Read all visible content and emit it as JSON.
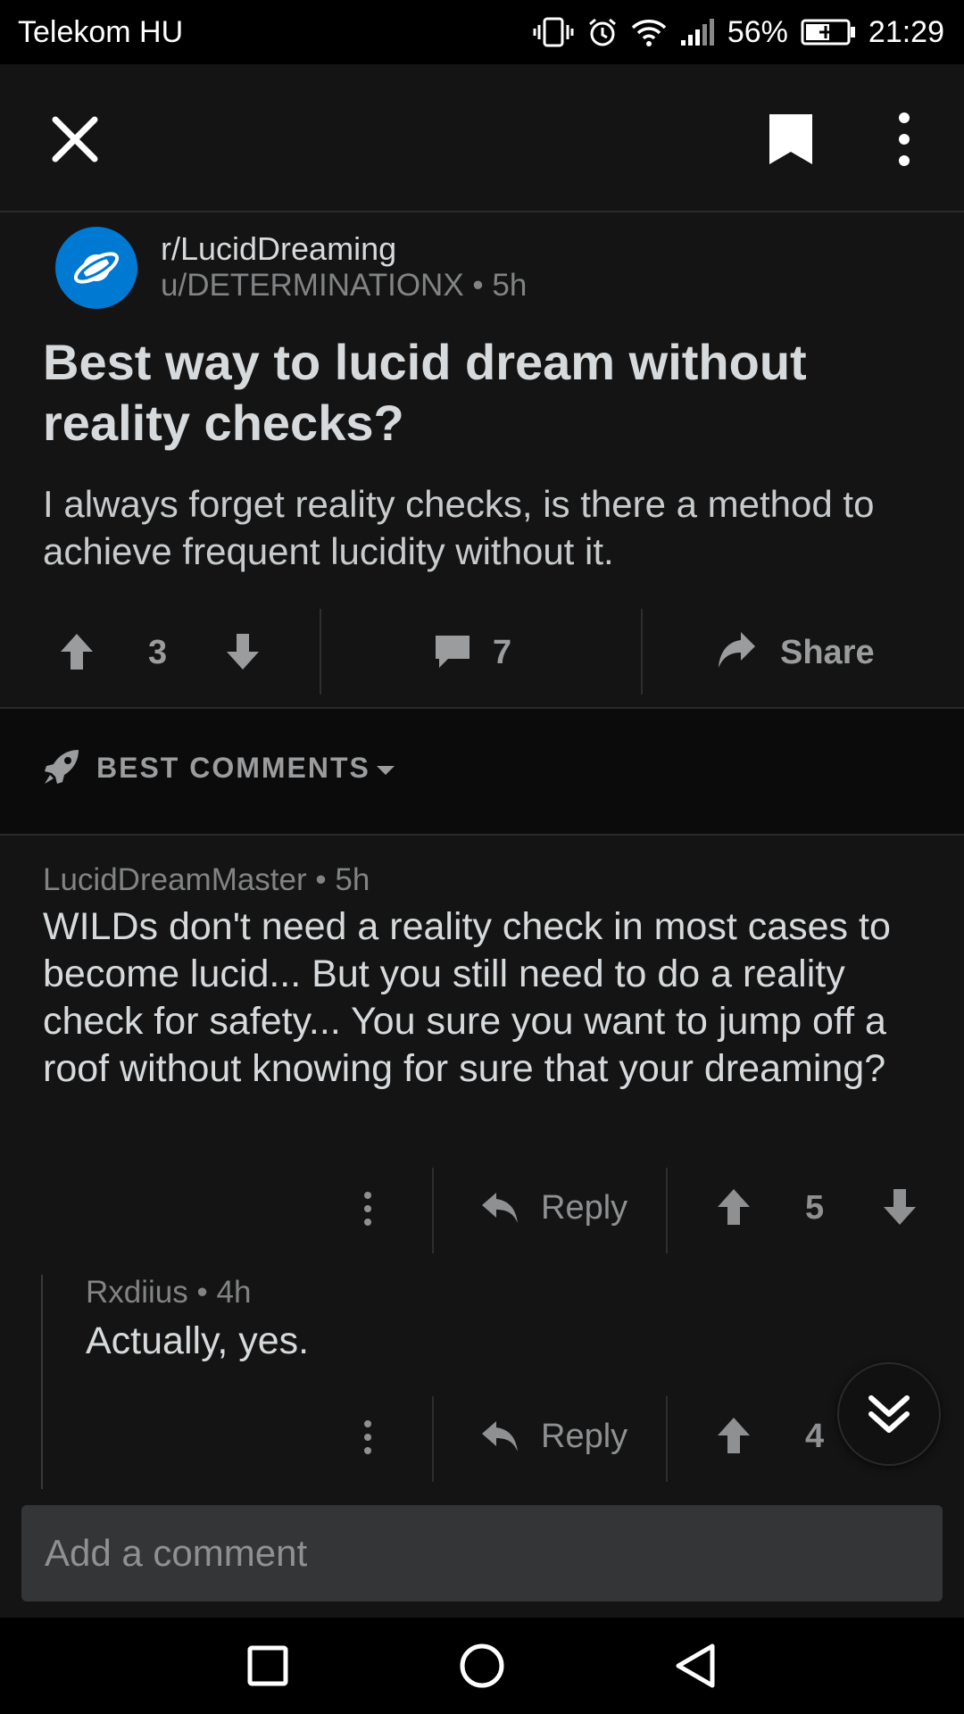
{
  "status_bar": {
    "carrier": "Telekom HU",
    "battery": "56%",
    "time": "21:29"
  },
  "post": {
    "subreddit": "r/LucidDreaming",
    "author": "u/DETERMINATIONX",
    "age": "5h",
    "title": "Best way to lucid dream without reality checks?",
    "body": "I always forget reality checks, is there a method to achieve frequent lucidity without it.",
    "votes": "3",
    "comments_count": "7",
    "share_label": "Share"
  },
  "sort": {
    "label": "BEST COMMENTS"
  },
  "comments": [
    {
      "author": "LucidDreamMaster",
      "age": "5h",
      "body": "WILDs don't need a reality check in most cases to become lucid... But you still need to do a reality check for safety... You sure you want to jump off a roof without knowing for sure that your dreaming?",
      "reply_label": "Reply",
      "votes": "5"
    },
    {
      "author": "Rxdiius",
      "age": "4h",
      "body": "Actually, yes.",
      "reply_label": "Reply",
      "votes": "4"
    }
  ],
  "composer": {
    "placeholder": "Add a comment"
  },
  "colors": {
    "background": "#141414",
    "avatar_blue": "#0079d3",
    "muted_text": "#818384"
  }
}
